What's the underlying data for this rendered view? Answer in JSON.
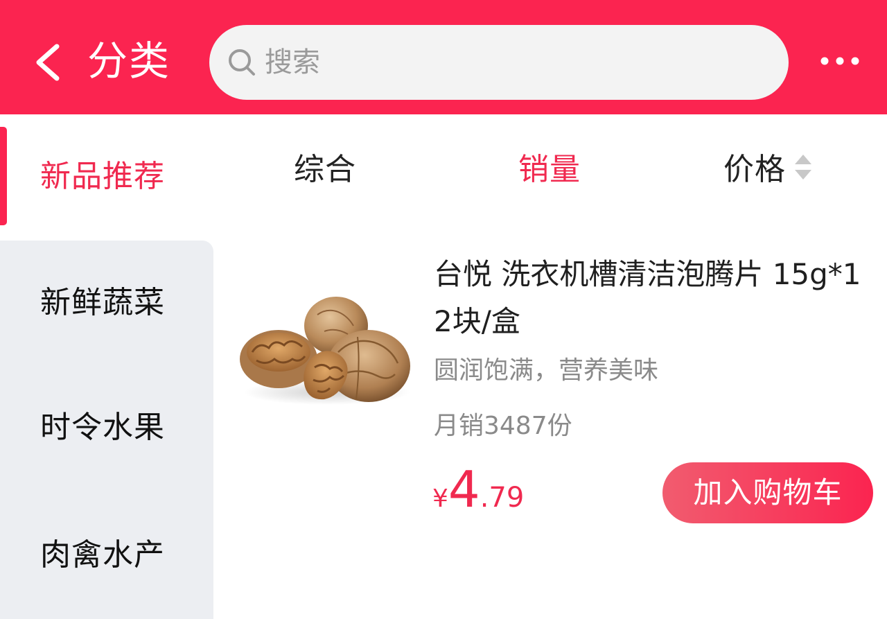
{
  "header": {
    "title": "分类",
    "back_icon": "chevron-left-icon",
    "more_icon": "more-dots-icon",
    "background_color": "#fb2450"
  },
  "search": {
    "placeholder": "搜索",
    "icon": "search-icon"
  },
  "sidebar": {
    "items": [
      {
        "label": "新品推荐",
        "active": true
      },
      {
        "label": "新鲜蔬菜",
        "active": false
      },
      {
        "label": "时令水果",
        "active": false
      },
      {
        "label": "肉禽水产",
        "active": false
      }
    ]
  },
  "sort_bar": {
    "tabs": [
      {
        "label": "综合",
        "active": false
      },
      {
        "label": "销量",
        "active": true
      },
      {
        "label": "价格",
        "active": false,
        "icon": "sort-arrows-icon"
      }
    ]
  },
  "products": [
    {
      "image_icon": "walnut-image",
      "title": "台悦 洗衣机槽清洁泡腾片 15g*12块/盒",
      "subtitle": "圆润饱满，营养美味",
      "sales": "月销3487份",
      "price_currency": "¥",
      "price_int": "4",
      "price_dec": ".79",
      "cart_button_label": "加入购物车"
    }
  ],
  "colors": {
    "accent": "#fb2450",
    "active_text": "#f0294f",
    "sidebar_bg": "#eceef2",
    "muted_text": "#8a8a8a"
  }
}
